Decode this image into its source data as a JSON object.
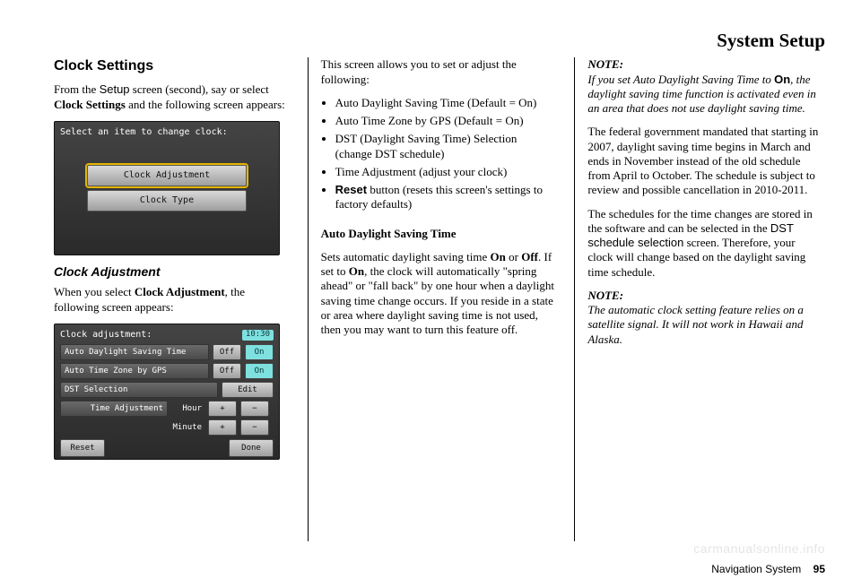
{
  "header": "System Setup",
  "footer_label": "Navigation System",
  "footer_page": "95",
  "watermark": "carmanualsonline.info",
  "col1": {
    "h1": "Clock Settings",
    "intro_pref": "From the ",
    "intro_setup": "Setup",
    "intro_mid": " screen (second), say or select ",
    "intro_cs": "Clock Settings",
    "intro_end": " and the following screen appears:",
    "s1_title": "Select an item to change clock:",
    "s1_btn1": "Clock Adjustment",
    "s1_btn2": "Clock Type",
    "h2": "Clock Adjustment",
    "adj_pref": "When you select ",
    "adj_bold": "Clock Adjustment",
    "adj_end": ", the following screen appears:",
    "s2_title": "Clock adjustment:",
    "s2_time": "10:30",
    "s2_r1": "Auto Daylight Saving Time",
    "s2_r2": "Auto Time Zone by GPS",
    "s2_r3": "DST Selection",
    "s2_r4": "Time Adjustment",
    "s2_hour": "Hour",
    "s2_min": "Minute",
    "off": "Off",
    "on": "On",
    "edit": "Edit",
    "plus": "+",
    "minus": "−",
    "reset": "Reset",
    "done": "Done"
  },
  "col2": {
    "p1": "This screen allows you to set or adjust the following:",
    "li1": "Auto Daylight Saving Time (Default = On)",
    "li2": "Auto Time Zone by GPS (Default = On)",
    "li3": "DST (Daylight Saving Time) Selection (change DST schedule)",
    "li4": "Time Adjustment (adjust your clock)",
    "li5_bold": "Reset",
    "li5_rest": " button (resets this screen's settings to factory defaults)",
    "sub": "Auto Daylight Saving Time",
    "p2a": "Sets automatic daylight saving time ",
    "p2on1": "On",
    "p2b": " or ",
    "p2off": "Off",
    "p2c": ". If set to ",
    "p2on2": "On",
    "p2d": ", the clock will automatically \"spring ahead\" or \"fall back\" by one hour when a daylight saving time change occurs. If you reside in a state or area where daylight saving time is not used, then you may want to turn this feature off."
  },
  "col3": {
    "note1_lbl": "NOTE:",
    "note1_a": "If you set Auto Daylight Saving Time to ",
    "note1_on": "On",
    "note1_b": ", the daylight saving time function is activated even in an area that does not use daylight saving time.",
    "p3": "The federal government mandated that starting in 2007, daylight saving time begins in March and ends in November instead of the old schedule from April to October. The schedule is subject to review and possible cancellation in 2010-2011.",
    "p4a": "The schedules for the time changes are stored in the software and can be selected in the ",
    "p4_sans": "DST schedule selection",
    "p4b": " screen. Therefore, your clock will change based on the daylight saving time schedule.",
    "note2_lbl": "NOTE:",
    "note2": "The automatic clock setting feature relies on a satellite signal. It will not work in Hawaii and Alaska."
  }
}
